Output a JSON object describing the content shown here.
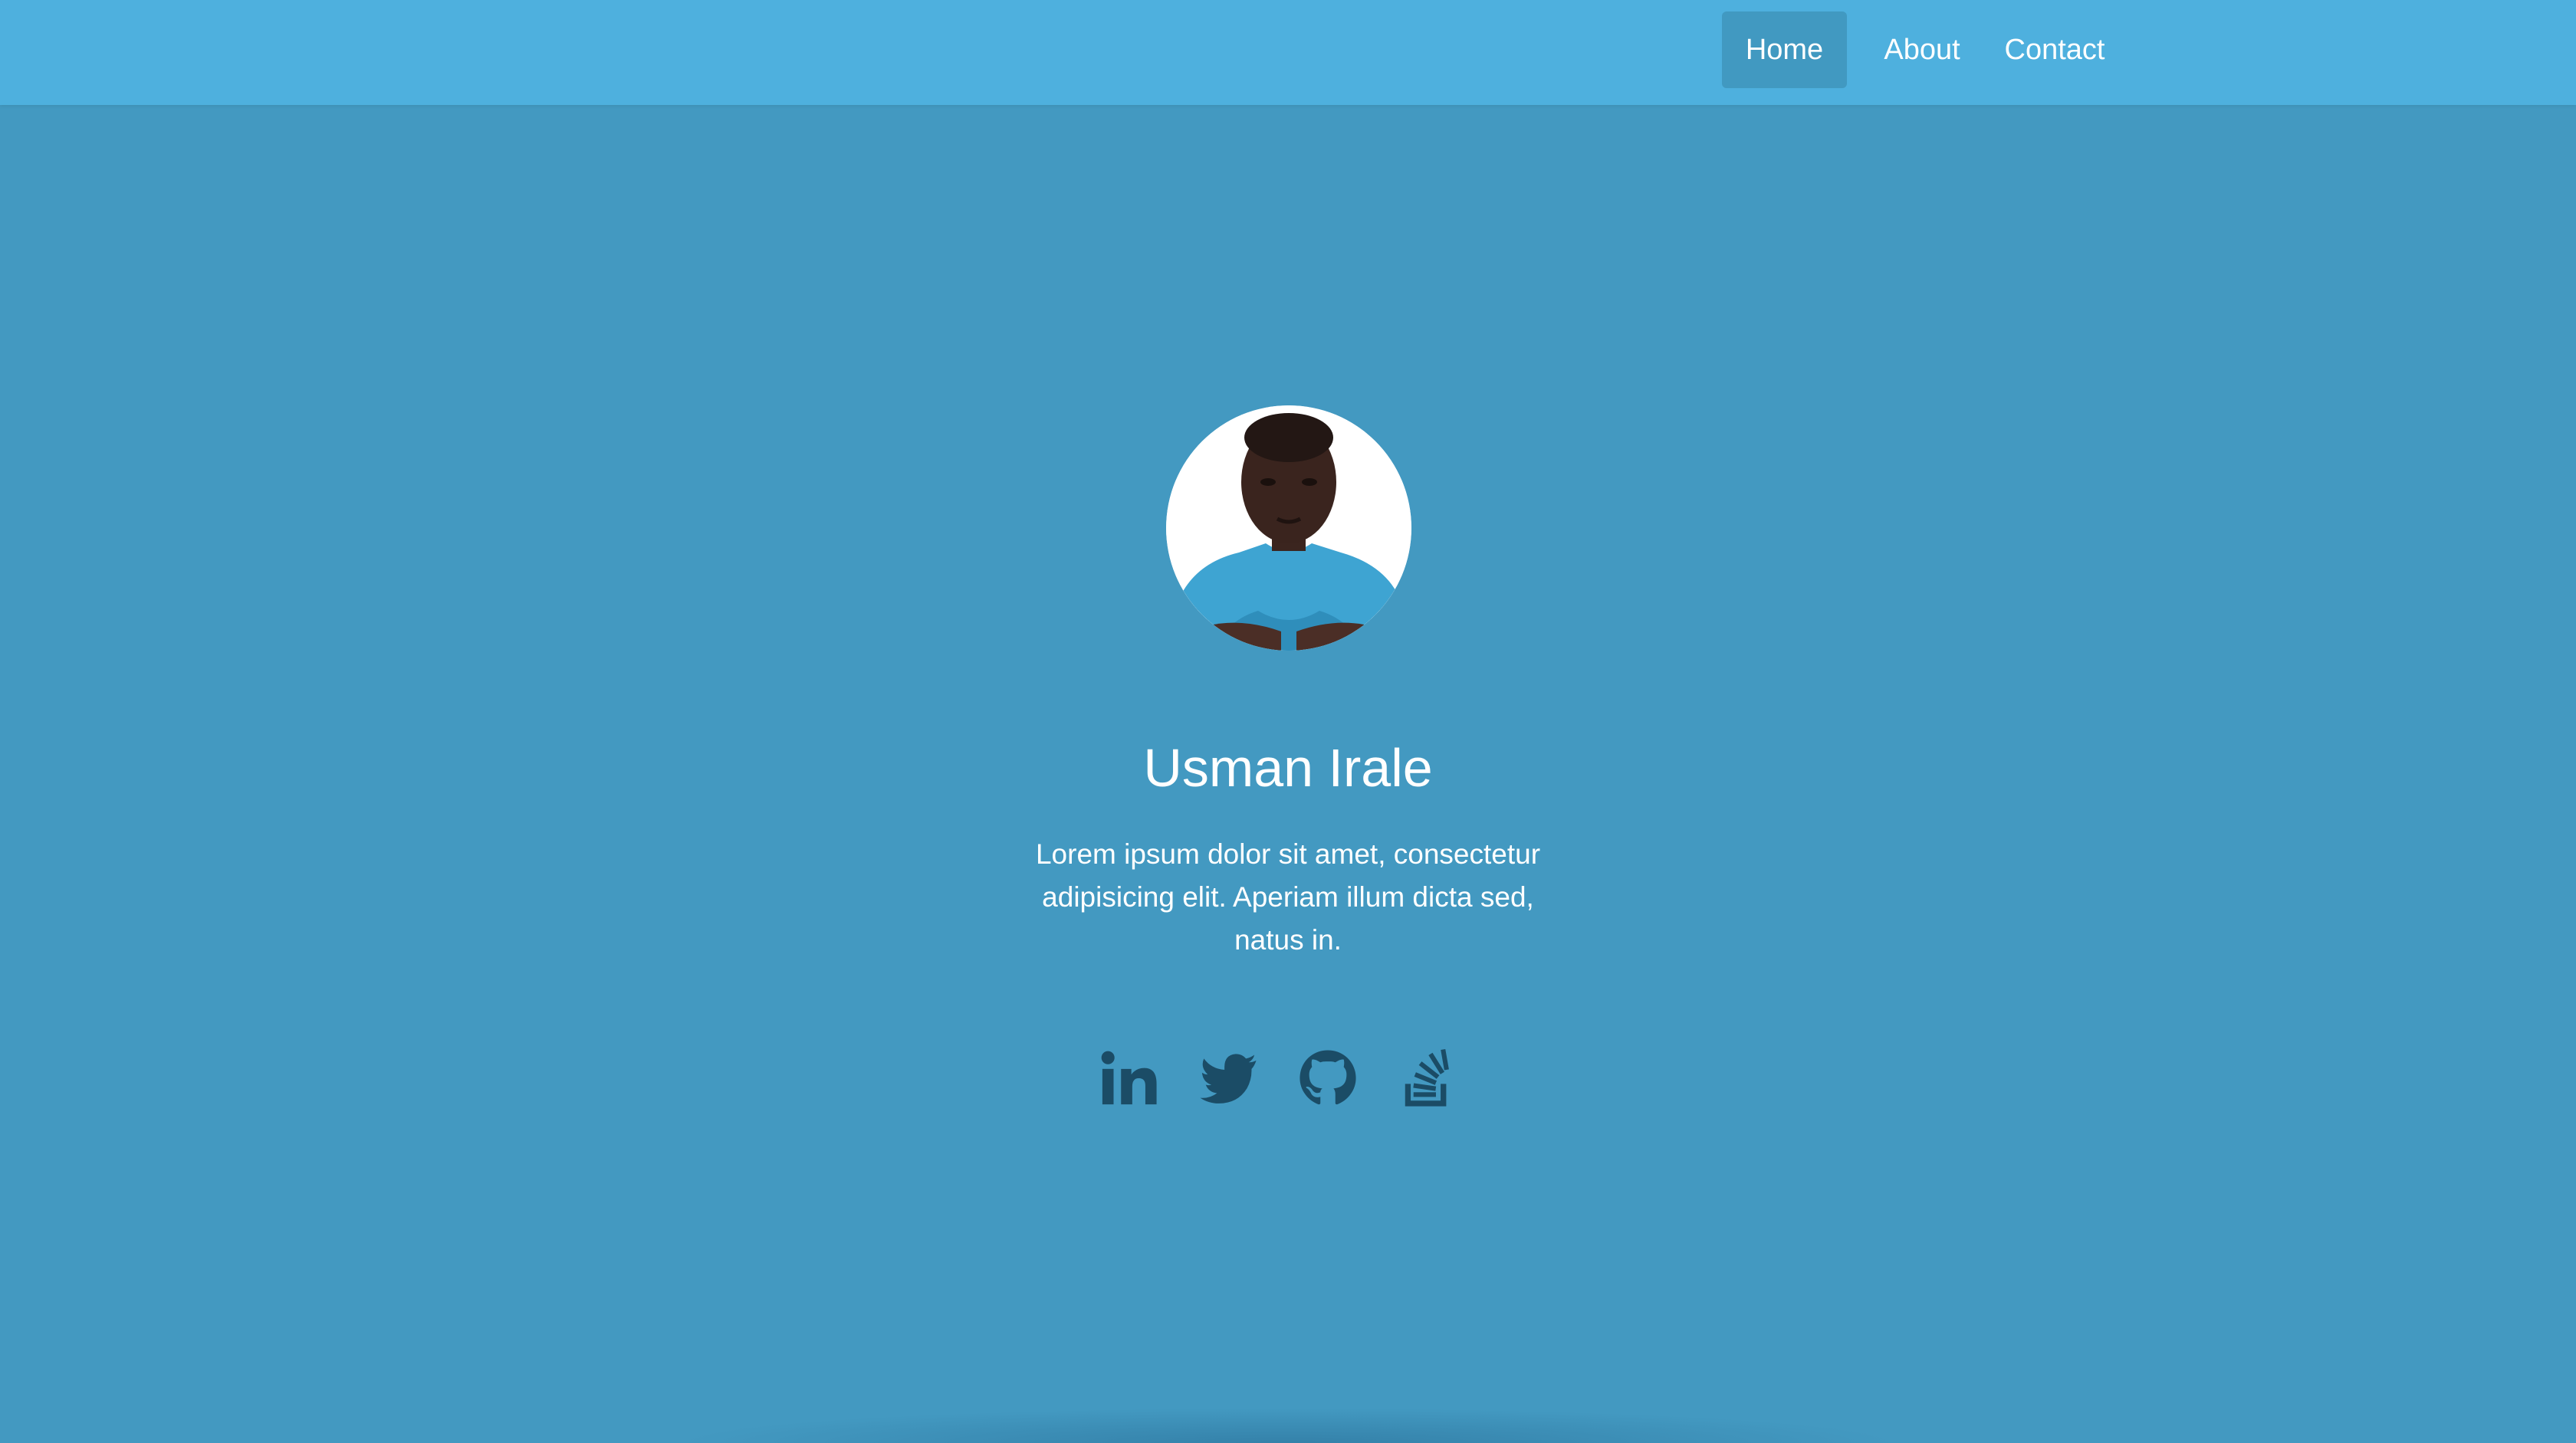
{
  "nav": {
    "items": [
      {
        "label": "Home",
        "active": true
      },
      {
        "label": "About",
        "active": false
      },
      {
        "label": "Contact",
        "active": false
      }
    ]
  },
  "profile": {
    "name": "Usman Irale",
    "bio": "Lorem ipsum dolor sit amet, consectetur adipisicing elit. Aperiam illum dicta sed, natus in."
  },
  "social": [
    {
      "icon": "linkedin-icon"
    },
    {
      "icon": "twitter-icon"
    },
    {
      "icon": "github-icon"
    },
    {
      "icon": "stackoverflow-icon"
    }
  ],
  "colors": {
    "navbar": "#4eb0de",
    "background": "#4399c1",
    "nav_active": "#4199c1",
    "icons": "#1b4c66",
    "text": "#ffffff"
  }
}
